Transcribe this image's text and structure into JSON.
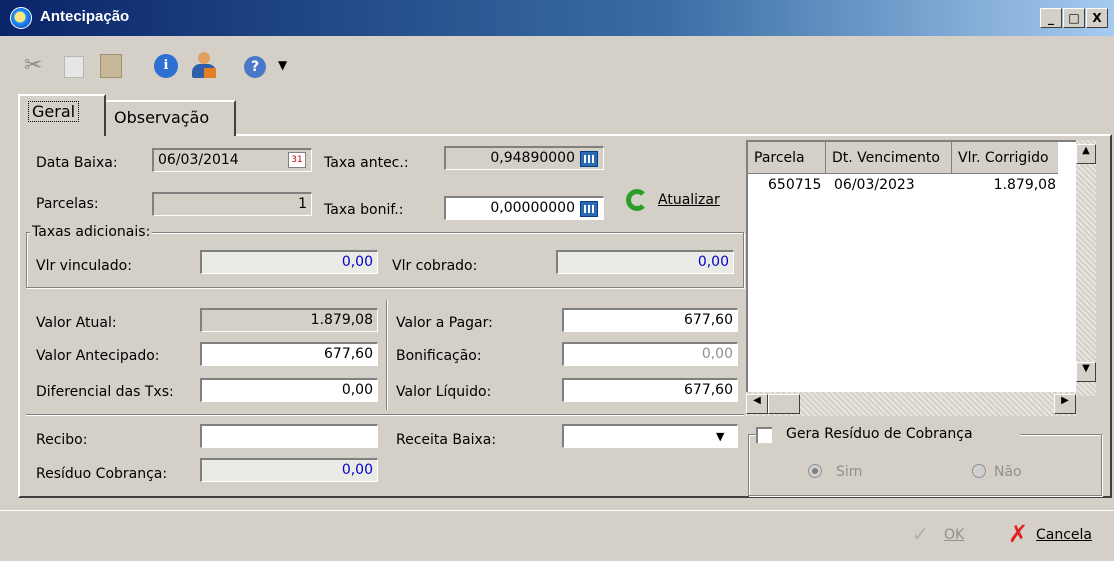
{
  "window": {
    "title": "Antecipação",
    "controls": [
      "_",
      "□",
      "X"
    ]
  },
  "toolbar": {
    "icons": [
      "cut-icon",
      "copy-icon",
      "paste-icon",
      "info-icon",
      "user-icon",
      "help-icon",
      "dropdown-arrow-icon"
    ]
  },
  "tabs": [
    {
      "label": "Geral",
      "active": true
    },
    {
      "label": "Observação",
      "active": false
    }
  ],
  "form": {
    "data_baixa_label": "Data Baixa:",
    "data_baixa_value": "06/03/2014",
    "taxa_antec_label": "Taxa antec.:",
    "taxa_antec_value": "0,94890000",
    "parcelas_label": "Parcelas:",
    "parcelas_value": "1",
    "taxa_bonif_label": "Taxa bonif.:",
    "taxa_bonif_value": "0,00000000",
    "atualizar_label": "Atualizar",
    "taxas_adicionais_label": "Taxas adicionais:",
    "vlr_vinculado_label": "Vlr vinculado:",
    "vlr_vinculado_value": "0,00",
    "vlr_cobrado_label": "Vlr cobrado:",
    "vlr_cobrado_value": "0,00",
    "valor_atual_label": "Valor Atual:",
    "valor_atual_value": "1.879,08",
    "valor_antecipado_label": "Valor Antecipado:",
    "valor_antecipado_value": "677,60",
    "diferencial_label": "Diferencial das Txs:",
    "diferencial_value": "0,00",
    "valor_a_pagar_label": "Valor a Pagar:",
    "valor_a_pagar_value": "677,60",
    "bonificacao_label": "Bonificação:",
    "bonificacao_value": "0,00",
    "valor_liquido_label": "Valor Líquido:",
    "valor_liquido_value": "677,60",
    "recibo_label": "Recibo:",
    "recibo_value": "",
    "receita_baixa_label": "Receita Baixa:",
    "receita_baixa_value": "",
    "residuo_cobranca_label": "Resíduo Cobrança:",
    "residuo_cobranca_value": "0,00"
  },
  "grid": {
    "columns": [
      "Parcela",
      "Dt. Vencimento",
      "Vlr. Corrigido"
    ],
    "rows": [
      {
        "parcela": "650715",
        "dt_vencimento": "06/03/2023",
        "vlr_corrigido": "1.879,08"
      }
    ]
  },
  "residuo_group": {
    "label": "Gera Resíduo de Cobrança",
    "checked": false,
    "options": [
      {
        "label": "Sim",
        "selected": true
      },
      {
        "label": "Não",
        "selected": false
      }
    ]
  },
  "buttons": {
    "ok_label": "OK",
    "cancela_label": "Cancela"
  }
}
